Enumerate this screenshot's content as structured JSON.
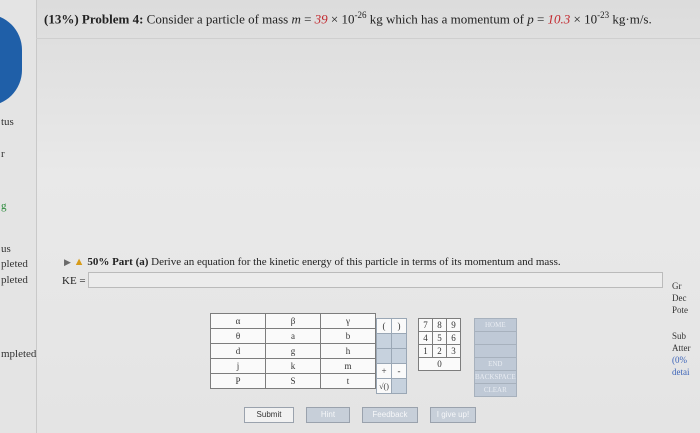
{
  "left_nav": {
    "labels": [
      "tus",
      "r",
      "g",
      "us",
      "pleted",
      "pleted",
      "mpleted"
    ]
  },
  "problem": {
    "percent": "(13%)",
    "title": "Problem 4:",
    "text_a": "Consider a particle of mass",
    "m_sym": "m",
    "eq": "=",
    "m_val": "39",
    "times": "×",
    "ten": "10",
    "m_exp": "-26",
    "text_b": "kg which has a momentum of",
    "p_sym": "p",
    "p_val": "10.3",
    "p_exp": "-23",
    "unit": "kg·m/s."
  },
  "part_a": {
    "percent": "50%",
    "label": "Part (a)",
    "text": "Derive an equation for the kinetic energy of this particle in terms of its momentum and mass.",
    "answer_label": "KE =",
    "answer_value": ""
  },
  "right_panel": {
    "items": [
      "Gr",
      "Dec",
      "Pote",
      "Sub",
      "Atter",
      "(0%",
      "detai"
    ]
  },
  "keypad": {
    "greek_rows": [
      [
        "α",
        "β",
        "γ"
      ],
      [
        "θ",
        "a",
        "b"
      ],
      [
        "d",
        "g",
        "h"
      ],
      [
        "j",
        "k",
        "m"
      ],
      [
        "P",
        "S",
        "t"
      ]
    ],
    "ops": [
      "(",
      ")",
      "",
      "",
      "",
      "",
      "+",
      "-",
      "√()",
      ""
    ],
    "digits": [
      "7",
      "8",
      "9",
      "4",
      "5",
      "6",
      "1",
      "2",
      "3",
      "0"
    ],
    "extras": [
      "HOME",
      "",
      "",
      "END",
      "BACKSPACE",
      "CLEAR"
    ]
  },
  "buttons": {
    "submit": "Submit",
    "hint": "Hint",
    "feedback": "Feedback",
    "giveup": "I give up!"
  }
}
